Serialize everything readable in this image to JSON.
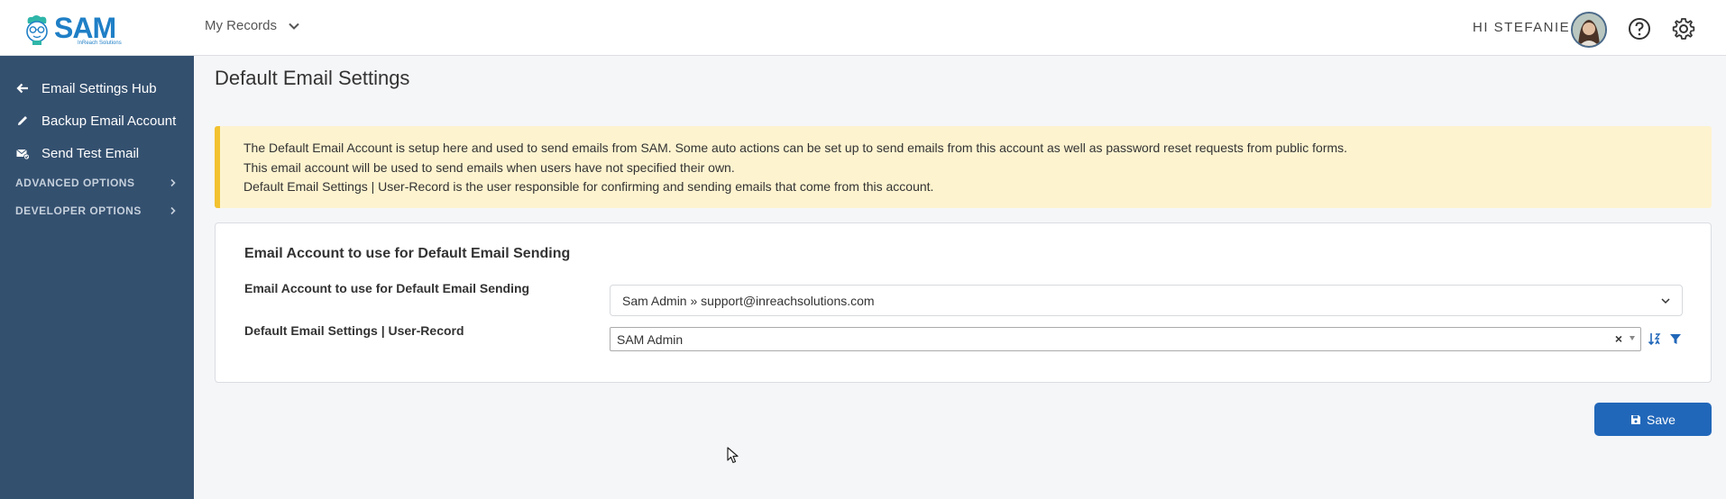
{
  "app": {
    "logo_text": "SAM",
    "logo_subtext": "InReach Solutions"
  },
  "header": {
    "records_menu": "My Records",
    "greeting": "HI STEFANIE"
  },
  "sidebar": {
    "items": [
      {
        "label": "Email Settings Hub",
        "icon": "arrow-left-icon"
      },
      {
        "label": "Backup Email Account",
        "icon": "pencil-icon"
      },
      {
        "label": "Send Test Email",
        "icon": "envelope-check-icon"
      }
    ],
    "sections": [
      {
        "label": "ADVANCED OPTIONS"
      },
      {
        "label": "DEVELOPER OPTIONS"
      }
    ]
  },
  "main": {
    "title": "Default Email Settings",
    "notice_lines": [
      "The Default Email Account is setup here and used to send emails from SAM. Some auto actions can be set up to send emails from this account as well as password reset requests from public forms.",
      "This email account will be used to send emails when users have not specified their own.",
      "Default Email Settings | User-Record is the user responsible for confirming and sending emails that come from this account."
    ],
    "card": {
      "title": "Email Account to use for Default Email Sending",
      "fields": [
        {
          "label": "Email Account to use for Default Email Sending",
          "value": "Sam Admin » support@inreachsolutions.com"
        },
        {
          "label": "Default Email Settings | User-Record",
          "value": "SAM Admin"
        }
      ]
    },
    "save_label": "Save"
  },
  "colors": {
    "sidebar_bg": "#34506f",
    "primary": "#2167b9",
    "notice_bg": "#fdf3cf",
    "notice_border": "#f2c230",
    "brand": "#1f7fc6"
  }
}
